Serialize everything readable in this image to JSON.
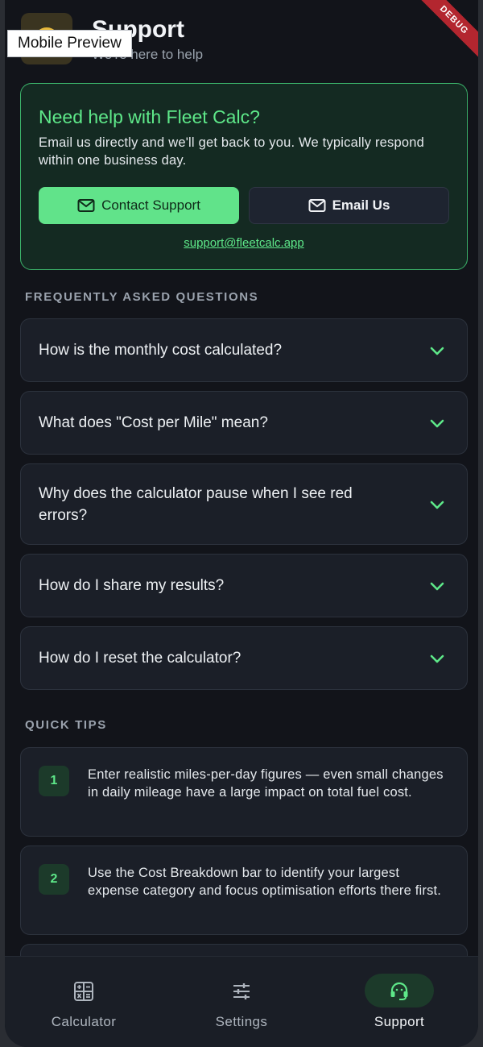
{
  "overlay": {
    "preview_label": "Mobile Preview",
    "debug_label": "DEBUG"
  },
  "header": {
    "title": "Support",
    "subtitle": "We're here to help"
  },
  "help_card": {
    "title": "Need help with Fleet Calc?",
    "text": "Email us directly and we'll get back to you. We typically respond within one business day.",
    "contact_button": "Contact Support",
    "email_button": "Email Us",
    "email": "support@fleetcalc.app"
  },
  "faq": {
    "heading": "FREQUENTLY ASKED QUESTIONS",
    "items": [
      {
        "question": "How is the monthly cost calculated?"
      },
      {
        "question": "What does \"Cost per Mile\" mean?"
      },
      {
        "question": "Why does the calculator pause when I see red errors?"
      },
      {
        "question": "How do I share my results?"
      },
      {
        "question": "How do I reset the calculator?"
      }
    ]
  },
  "tips": {
    "heading": "QUICK TIPS",
    "items": [
      {
        "number": "1",
        "text": "Enter realistic miles-per-day figures — even small changes in daily mileage have a large impact on total fuel cost."
      },
      {
        "number": "2",
        "text": "Use the Cost Breakdown bar to identify your largest expense category and focus optimisation efforts there first."
      }
    ]
  },
  "tabbar": {
    "tabs": [
      {
        "label": "Calculator",
        "icon": "calculator-icon"
      },
      {
        "label": "Settings",
        "icon": "sliders-icon"
      },
      {
        "label": "Support",
        "icon": "headset-icon",
        "active": true
      }
    ]
  },
  "colors": {
    "accent": "#5ee889",
    "background": "#12141a",
    "card": "#1b1f28"
  }
}
